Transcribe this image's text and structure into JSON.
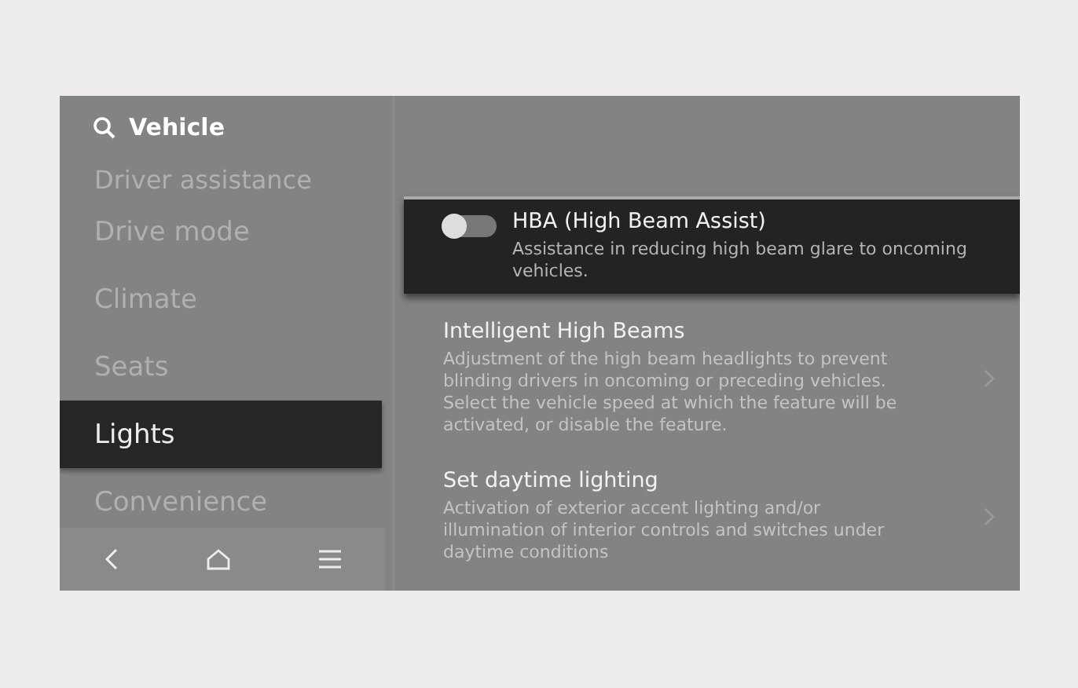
{
  "header": {
    "title": "Vehicle"
  },
  "sidebar": {
    "items": [
      {
        "label": "Driver assistance",
        "selected": false
      },
      {
        "label": "Drive mode",
        "selected": false
      },
      {
        "label": "Climate",
        "selected": false
      },
      {
        "label": "Seats",
        "selected": false
      },
      {
        "label": "Lights",
        "selected": true
      },
      {
        "label": "Convenience",
        "selected": false
      }
    ]
  },
  "settings": [
    {
      "kind": "toggle",
      "title": "HBA (High Beam Assist)",
      "description": "Assistance in reducing high beam glare to oncoming vehicles.",
      "on": false,
      "selected": true
    },
    {
      "kind": "link",
      "title": "Intelligent High Beams",
      "description": "Adjustment of the high beam headlights to prevent blinding drivers in oncoming or preceding vehicles. Select the vehicle speed at which the feature will be activated, or disable the feature.",
      "selected": false
    },
    {
      "kind": "link",
      "title": "Set daytime lighting",
      "description": "Activation of exterior accent lighting and/or illumination of interior controls and switches under daytime conditions",
      "selected": false
    }
  ]
}
